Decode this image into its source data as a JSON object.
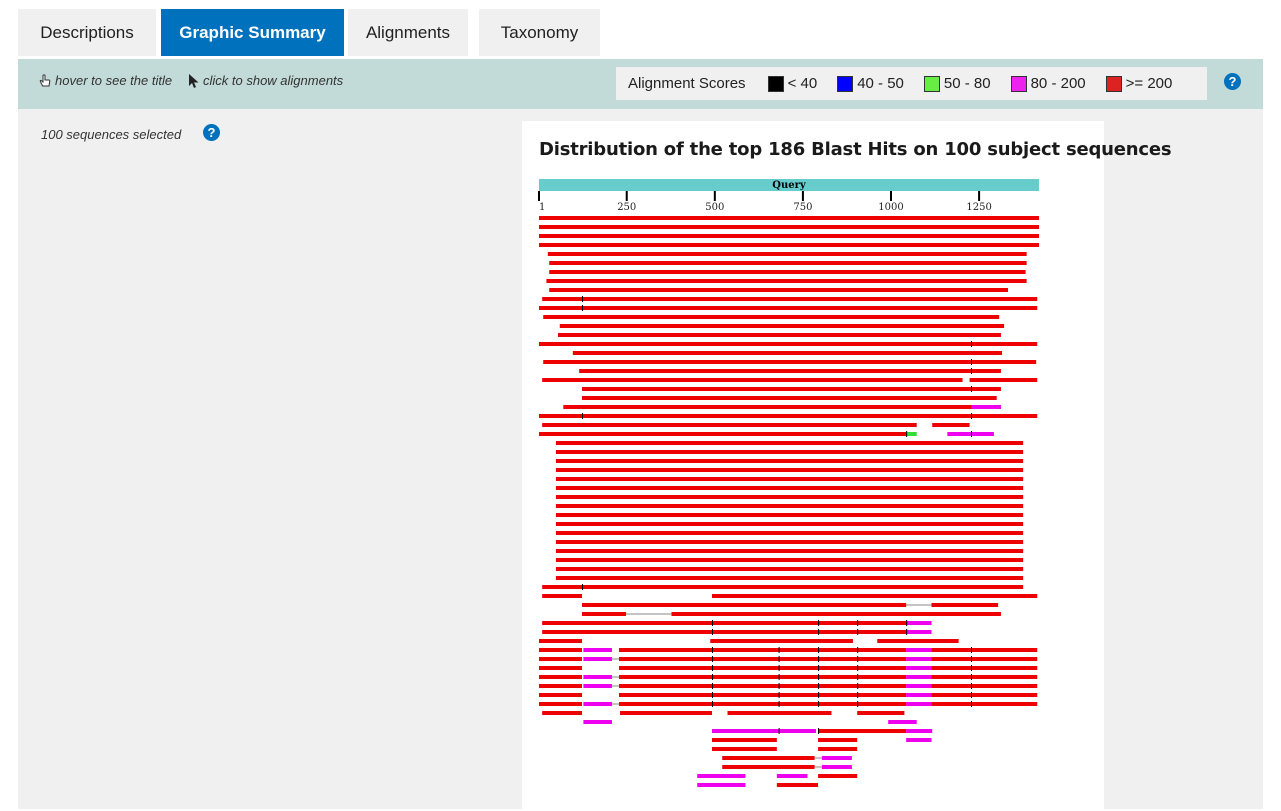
{
  "tabs": [
    {
      "label": "Descriptions",
      "active": false
    },
    {
      "label": "Graphic Summary",
      "active": true
    },
    {
      "label": "Alignments",
      "active": false
    },
    {
      "label": "Taxonomy",
      "active": false
    }
  ],
  "toolbar": {
    "hover_hint": "hover to see the title",
    "click_hint": "click to show alignments",
    "scores_label": "Alignment Scores",
    "score_ranges": [
      {
        "label": "< 40",
        "color": "#000000"
      },
      {
        "label": "40 - 50",
        "color": "#0000ff"
      },
      {
        "label": "50 - 80",
        "color": "#66ee44"
      },
      {
        "label": "80 - 200",
        "color": "#ee22ee"
      },
      {
        "label": ">= 200",
        "color": "#dd2222"
      }
    ],
    "help": "?"
  },
  "sidebar": {
    "selected_text": "100 sequences selected",
    "help": "?"
  },
  "graphic": {
    "title": "Distribution of the top 186 Blast Hits on 100 subject sequences",
    "query_label": "Query",
    "query_length": 1420,
    "ticks": [
      1,
      250,
      500,
      750,
      1000,
      1250
    ],
    "query_bar_color": "#66cccc",
    "colors": {
      "red": "#ee0000",
      "magenta": "#ee00ee",
      "green": "#33dd33",
      "tick": "#000000",
      "gap": "#888888"
    },
    "hit_rows": [
      {
        "segments": [
          {
            "start": 1,
            "end": 1420,
            "score": "red"
          }
        ]
      },
      {
        "segments": [
          {
            "start": 1,
            "end": 1420,
            "score": "red"
          }
        ]
      },
      {
        "segments": [
          {
            "start": 1,
            "end": 1420,
            "score": "red"
          }
        ]
      },
      {
        "segments": [
          {
            "start": 1,
            "end": 1420,
            "score": "red"
          }
        ]
      },
      {
        "segments": [
          {
            "start": 26,
            "end": 1385,
            "score": "red"
          }
        ]
      },
      {
        "segments": [
          {
            "start": 30,
            "end": 1385,
            "score": "red"
          }
        ]
      },
      {
        "segments": [
          {
            "start": 30,
            "end": 1382,
            "score": "red"
          }
        ]
      },
      {
        "segments": [
          {
            "start": 22,
            "end": 1385,
            "score": "red"
          }
        ]
      },
      {
        "segments": [
          {
            "start": 30,
            "end": 1332,
            "score": "red"
          }
        ]
      },
      {
        "segments": [
          {
            "start": 10,
            "end": 1415,
            "score": "red"
          }
        ],
        "marks": [
          123
        ]
      },
      {
        "segments": [
          {
            "start": 1,
            "end": 1415,
            "score": "red"
          }
        ],
        "marks": [
          123
        ]
      },
      {
        "segments": [
          {
            "start": 13,
            "end": 1307,
            "score": "red"
          }
        ]
      },
      {
        "segments": [
          {
            "start": 60,
            "end": 1321,
            "score": "red"
          }
        ]
      },
      {
        "segments": [
          {
            "start": 55,
            "end": 1312,
            "score": "red"
          }
        ]
      },
      {
        "segments": [
          {
            "start": 1,
            "end": 1415,
            "score": "red"
          }
        ],
        "marks": [
          1227
        ]
      },
      {
        "segments": [
          {
            "start": 97,
            "end": 1315,
            "score": "red"
          }
        ]
      },
      {
        "segments": [
          {
            "start": 13,
            "end": 1412,
            "score": "red"
          }
        ],
        "marks": [
          1227
        ]
      },
      {
        "segments": [
          {
            "start": 115,
            "end": 1312,
            "score": "red"
          }
        ],
        "marks": [
          1227
        ]
      },
      {
        "segments": [
          {
            "start": 10,
            "end": 1203,
            "score": "red"
          },
          {
            "start": 1223,
            "end": 1415,
            "score": "red"
          }
        ]
      },
      {
        "segments": [
          {
            "start": 123,
            "end": 1312,
            "score": "red"
          }
        ],
        "marks": [
          1227
        ]
      },
      {
        "segments": [
          {
            "start": 123,
            "end": 1300,
            "score": "red"
          }
        ]
      },
      {
        "segments": [
          {
            "start": 70,
            "end": 1227,
            "score": "red"
          },
          {
            "start": 1227,
            "end": 1312,
            "score": "magenta"
          }
        ]
      },
      {
        "segments": [
          {
            "start": 1,
            "end": 1415,
            "score": "red"
          }
        ],
        "marks": [
          123,
          1227
        ]
      },
      {
        "segments": [
          {
            "start": 10,
            "end": 1073,
            "score": "red"
          },
          {
            "start": 1117,
            "end": 1223,
            "score": "red"
          }
        ]
      },
      {
        "segments": [
          {
            "start": 1,
            "end": 1043,
            "score": "red"
          },
          {
            "start": 1043,
            "end": 1073,
            "score": "green"
          },
          {
            "start": 1160,
            "end": 1292,
            "score": "magenta"
          }
        ],
        "marks": [
          1043,
          1227
        ]
      },
      {
        "segments": [
          {
            "start": 49,
            "end": 1375,
            "score": "red"
          }
        ]
      },
      {
        "segments": [
          {
            "start": 49,
            "end": 1375,
            "score": "red"
          }
        ]
      },
      {
        "segments": [
          {
            "start": 49,
            "end": 1375,
            "score": "red"
          }
        ]
      },
      {
        "segments": [
          {
            "start": 49,
            "end": 1375,
            "score": "red"
          }
        ]
      },
      {
        "segments": [
          {
            "start": 49,
            "end": 1375,
            "score": "red"
          }
        ]
      },
      {
        "segments": [
          {
            "start": 49,
            "end": 1375,
            "score": "red"
          }
        ]
      },
      {
        "segments": [
          {
            "start": 49,
            "end": 1375,
            "score": "red"
          }
        ]
      },
      {
        "segments": [
          {
            "start": 49,
            "end": 1375,
            "score": "red"
          }
        ]
      },
      {
        "segments": [
          {
            "start": 49,
            "end": 1375,
            "score": "red"
          }
        ]
      },
      {
        "segments": [
          {
            "start": 49,
            "end": 1375,
            "score": "red"
          }
        ]
      },
      {
        "segments": [
          {
            "start": 49,
            "end": 1375,
            "score": "red"
          }
        ]
      },
      {
        "segments": [
          {
            "start": 49,
            "end": 1375,
            "score": "red"
          }
        ]
      },
      {
        "segments": [
          {
            "start": 49,
            "end": 1375,
            "score": "red"
          }
        ]
      },
      {
        "segments": [
          {
            "start": 49,
            "end": 1375,
            "score": "red"
          }
        ]
      },
      {
        "segments": [
          {
            "start": 49,
            "end": 1375,
            "score": "red"
          }
        ]
      },
      {
        "segments": [
          {
            "start": 49,
            "end": 1375,
            "score": "red"
          }
        ]
      },
      {
        "segments": [
          {
            "start": 10,
            "end": 1375,
            "score": "red"
          }
        ],
        "marks": [
          123
        ]
      },
      {
        "segments": [
          {
            "start": 10,
            "end": 123,
            "score": "red"
          },
          {
            "start": 492,
            "end": 1415,
            "score": "red"
          }
        ]
      },
      {
        "segments": [
          {
            "start": 123,
            "end": 1043,
            "score": "red"
          },
          {
            "start": 1115,
            "end": 1304,
            "score": "red"
          }
        ],
        "gaps": [
          [
            1043,
            1115
          ]
        ]
      },
      {
        "segments": [
          {
            "start": 123,
            "end": 248,
            "score": "red"
          },
          {
            "start": 377,
            "end": 1312,
            "score": "red"
          }
        ],
        "gaps": [
          [
            248,
            377
          ]
        ]
      },
      {
        "segments": [
          {
            "start": 10,
            "end": 1043,
            "score": "red"
          },
          {
            "start": 1043,
            "end": 1115,
            "score": "magenta"
          }
        ],
        "marks": [
          492,
          793,
          904,
          1043
        ]
      },
      {
        "segments": [
          {
            "start": 10,
            "end": 1043,
            "score": "red"
          },
          {
            "start": 1043,
            "end": 1115,
            "score": "magenta"
          }
        ],
        "marks": [
          492,
          793,
          904,
          1043
        ]
      },
      {
        "segments": [
          {
            "start": 1,
            "end": 123,
            "score": "red"
          },
          {
            "start": 487,
            "end": 892,
            "score": "red"
          },
          {
            "start": 961,
            "end": 1192,
            "score": "red"
          }
        ]
      },
      {
        "segments": [
          {
            "start": 1,
            "end": 123,
            "score": "red"
          },
          {
            "start": 127,
            "end": 208,
            "score": "magenta"
          },
          {
            "start": 228,
            "end": 1043,
            "score": "red"
          },
          {
            "start": 1043,
            "end": 1115,
            "score": "magenta"
          },
          {
            "start": 1115,
            "end": 1415,
            "score": "red"
          }
        ],
        "marks": [
          492,
          681,
          793,
          904,
          1227
        ]
      },
      {
        "segments": [
          {
            "start": 1,
            "end": 123,
            "score": "red"
          },
          {
            "start": 127,
            "end": 208,
            "score": "magenta"
          },
          {
            "start": 228,
            "end": 1043,
            "score": "red"
          },
          {
            "start": 1043,
            "end": 1115,
            "score": "magenta"
          },
          {
            "start": 1115,
            "end": 1415,
            "score": "red"
          }
        ],
        "marks": [
          492,
          681,
          793,
          904,
          1227
        ],
        "gaps": [
          [
            208,
            228
          ]
        ]
      },
      {
        "segments": [
          {
            "start": 1,
            "end": 123,
            "score": "red"
          },
          {
            "start": 228,
            "end": 1043,
            "score": "red"
          },
          {
            "start": 1043,
            "end": 1115,
            "score": "magenta"
          },
          {
            "start": 1115,
            "end": 1415,
            "score": "red"
          }
        ],
        "marks": [
          492,
          681,
          793,
          904,
          1227
        ]
      },
      {
        "segments": [
          {
            "start": 1,
            "end": 123,
            "score": "red"
          },
          {
            "start": 127,
            "end": 208,
            "score": "magenta"
          },
          {
            "start": 228,
            "end": 1043,
            "score": "red"
          },
          {
            "start": 1043,
            "end": 1115,
            "score": "magenta"
          },
          {
            "start": 1115,
            "end": 1415,
            "score": "red"
          }
        ],
        "marks": [
          492,
          681,
          793,
          904,
          1227
        ],
        "gaps": [
          [
            208,
            228
          ]
        ]
      },
      {
        "segments": [
          {
            "start": 1,
            "end": 123,
            "score": "red"
          },
          {
            "start": 127,
            "end": 208,
            "score": "magenta"
          },
          {
            "start": 228,
            "end": 1043,
            "score": "red"
          },
          {
            "start": 1043,
            "end": 1115,
            "score": "magenta"
          },
          {
            "start": 1115,
            "end": 1415,
            "score": "red"
          }
        ],
        "marks": [
          492,
          681,
          793,
          904,
          1227
        ],
        "gaps": [
          [
            208,
            228
          ]
        ]
      },
      {
        "segments": [
          {
            "start": 1,
            "end": 123,
            "score": "red"
          },
          {
            "start": 228,
            "end": 1043,
            "score": "red"
          },
          {
            "start": 1043,
            "end": 1115,
            "score": "magenta"
          },
          {
            "start": 1115,
            "end": 1415,
            "score": "red"
          }
        ],
        "marks": [
          492,
          681,
          793,
          904,
          1227
        ]
      },
      {
        "segments": [
          {
            "start": 1,
            "end": 123,
            "score": "red"
          },
          {
            "start": 127,
            "end": 208,
            "score": "magenta"
          },
          {
            "start": 228,
            "end": 1043,
            "score": "red"
          },
          {
            "start": 1043,
            "end": 1115,
            "score": "magenta"
          },
          {
            "start": 1115,
            "end": 1415,
            "score": "red"
          }
        ],
        "marks": [
          492,
          681,
          793,
          904,
          1227
        ],
        "gaps": [
          [
            208,
            228
          ]
        ]
      },
      {
        "segments": [
          {
            "start": 10,
            "end": 123,
            "score": "red"
          },
          {
            "start": 231,
            "end": 492,
            "score": "red"
          },
          {
            "start": 536,
            "end": 831,
            "score": "red"
          },
          {
            "start": 904,
            "end": 1038,
            "score": "red"
          }
        ]
      },
      {
        "segments": [
          {
            "start": 127,
            "end": 208,
            "score": "magenta"
          },
          {
            "start": 992,
            "end": 1073,
            "score": "magenta"
          }
        ]
      },
      {
        "segments": [
          {
            "start": 492,
            "end": 681,
            "score": "magenta"
          },
          {
            "start": 681,
            "end": 787,
            "score": "magenta"
          },
          {
            "start": 793,
            "end": 1043,
            "score": "red"
          },
          {
            "start": 1043,
            "end": 1117,
            "score": "magenta"
          }
        ],
        "marks": [
          681,
          793
        ]
      },
      {
        "segments": [
          {
            "start": 492,
            "end": 676,
            "score": "red"
          },
          {
            "start": 793,
            "end": 904,
            "score": "red"
          },
          {
            "start": 1043,
            "end": 1115,
            "score": "magenta"
          }
        ]
      },
      {
        "segments": [
          {
            "start": 492,
            "end": 676,
            "score": "red"
          },
          {
            "start": 793,
            "end": 904,
            "score": "red"
          }
        ]
      },
      {
        "segments": [
          {
            "start": 521,
            "end": 783,
            "score": "red"
          },
          {
            "start": 804,
            "end": 889,
            "score": "magenta"
          }
        ],
        "gaps": [
          [
            783,
            804
          ]
        ]
      },
      {
        "segments": [
          {
            "start": 521,
            "end": 783,
            "score": "red"
          },
          {
            "start": 804,
            "end": 889,
            "score": "magenta"
          }
        ],
        "gaps": [
          [
            783,
            804
          ]
        ]
      },
      {
        "segments": [
          {
            "start": 450,
            "end": 587,
            "score": "magenta"
          },
          {
            "start": 676,
            "end": 763,
            "score": "magenta"
          },
          {
            "start": 793,
            "end": 904,
            "score": "red"
          }
        ]
      },
      {
        "segments": [
          {
            "start": 450,
            "end": 587,
            "score": "magenta"
          },
          {
            "start": 676,
            "end": 793,
            "score": "red"
          }
        ]
      }
    ]
  }
}
